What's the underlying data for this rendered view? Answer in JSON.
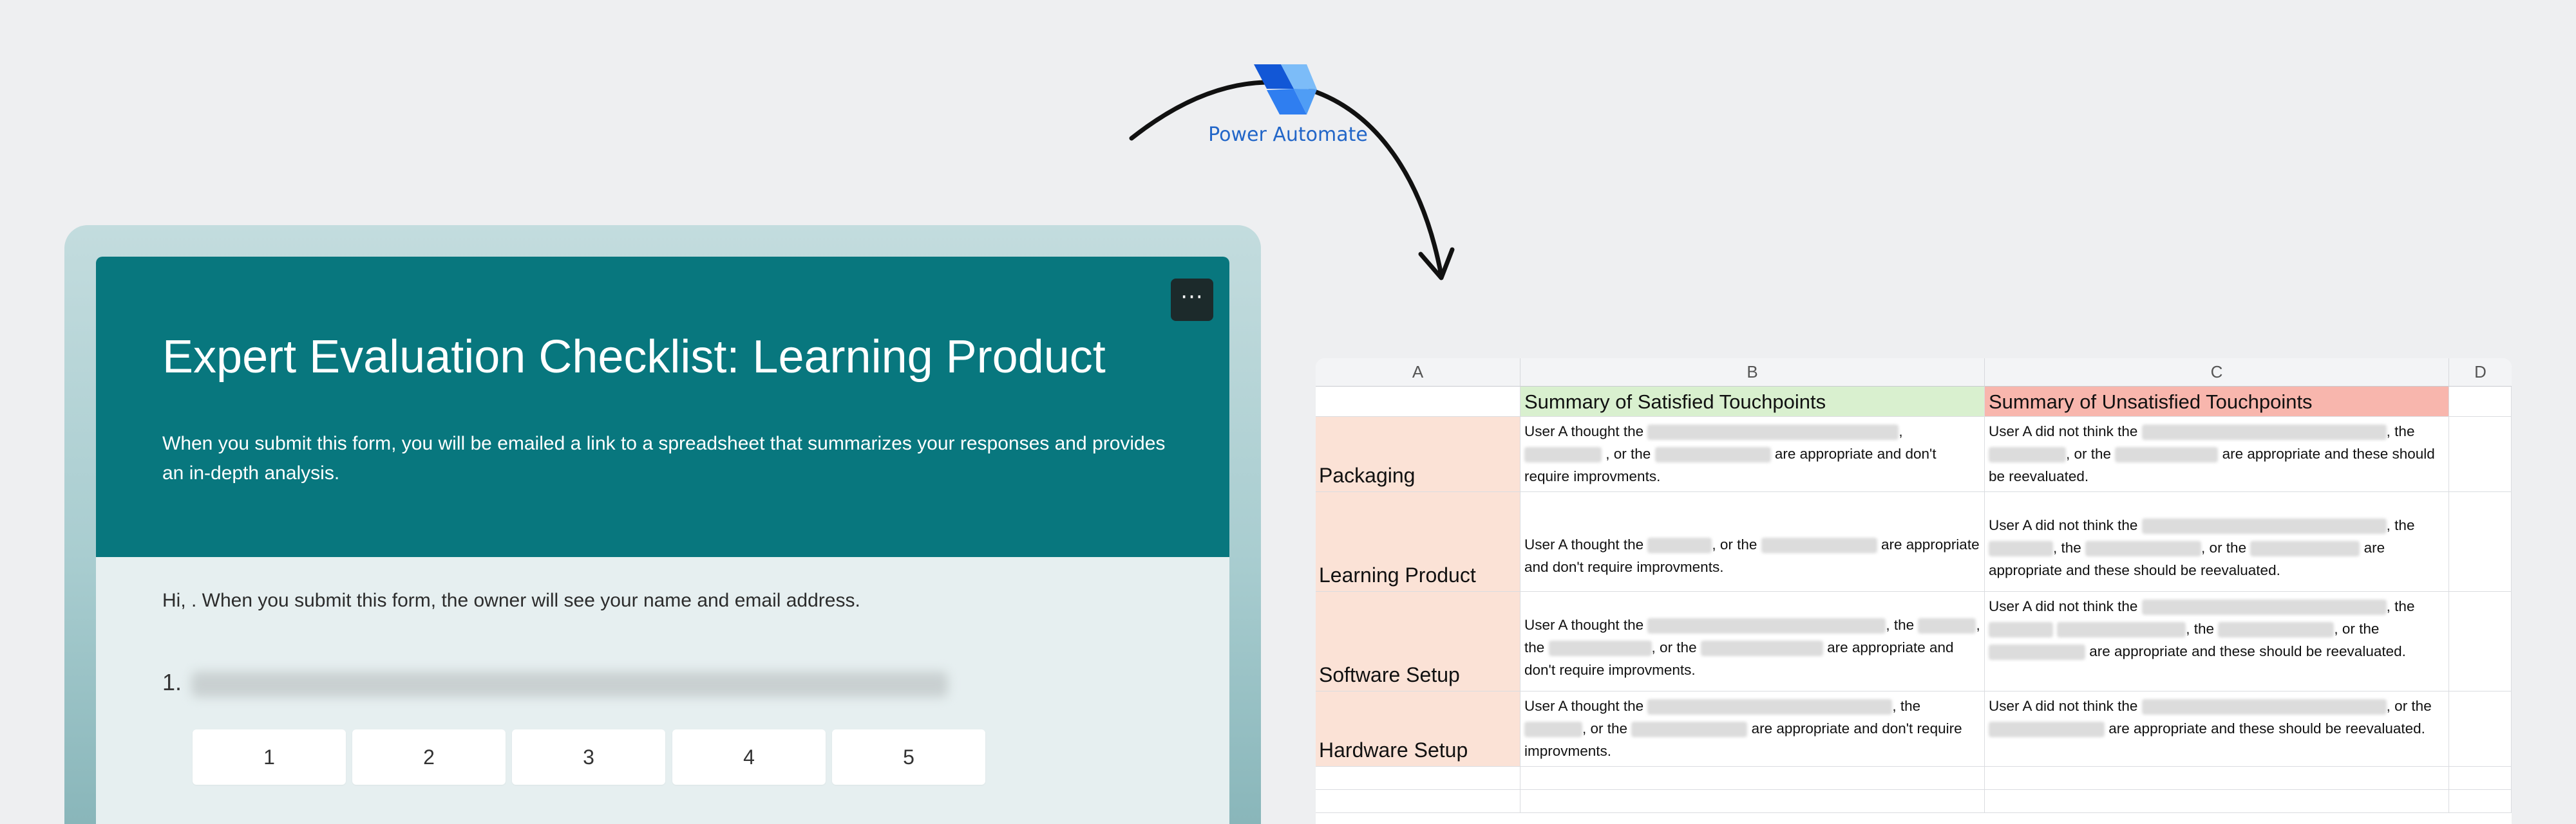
{
  "power_automate": {
    "label": "Power Automate",
    "colors": {
      "dark": "#1257d6",
      "mid": "#2f7ef0",
      "light": "#7cbcf8"
    }
  },
  "form": {
    "title": "Expert Evaluation Checklist: Learning Product",
    "subtitle": "When you submit this form, you will be emailed a link to a spreadsheet that summarizes your responses and provides an in-depth analysis.",
    "body_note": "Hi, . When you submit this form, the owner will see your name and email address.",
    "more_label": "···",
    "question_number": "1.",
    "rating_options": [
      "1",
      "2",
      "3",
      "4",
      "5"
    ],
    "colors": {
      "header": "#08777e",
      "body": "#e6eff0"
    }
  },
  "sheet": {
    "columns": [
      "A",
      "B",
      "C",
      "D"
    ],
    "header_satisfied": "Summary of Satisfied Touchpoints",
    "header_unsatisfied": "Summary of Unsatisfied Touchpoints",
    "rows": [
      {
        "label": "Packaging",
        "satisfied": {
          "a": "User A thought the",
          "b": ",",
          "c": ", or the",
          "d": "are appropriate and don't require improvments."
        },
        "unsatisfied": {
          "a": "User A did not think the",
          "b": ", the",
          "c": ", or the",
          "d": "are appropriate and these should be reevaluated."
        }
      },
      {
        "label": "Learning Product",
        "satisfied": {
          "a": "User A thought the",
          "b": ", or the",
          "c": "are appropriate and don't require improvments."
        },
        "unsatisfied": {
          "a": "User A did not think the",
          "b": ", the",
          "c": ", the",
          "d": ", or the",
          "e": "are appropriate and these should be reevaluated."
        }
      },
      {
        "label": "Software Setup",
        "satisfied": {
          "a": "User A thought the",
          "b": ", the",
          "c": ", the",
          "d": ", or the",
          "e": "are appropriate and don't require improvments."
        },
        "unsatisfied": {
          "a": "User A did not think the",
          "b": ", the",
          "c": ", the",
          "d": ", or the",
          "e": "are appropriate and these should be reevaluated."
        }
      },
      {
        "label": "Hardware Setup",
        "satisfied": {
          "a": "User A thought the",
          "b": ", the",
          "c": ", or the",
          "d": "are appropriate and don't require improvments."
        },
        "unsatisfied": {
          "a": "User A did not think the",
          "b": ",  or the",
          "c": "are appropriate and these should be reevaluated."
        }
      }
    ],
    "colors": {
      "satisfied": "#d9f0cf",
      "unsatisfied": "#f8b6ad",
      "row_label": "#fbe2d6"
    }
  }
}
